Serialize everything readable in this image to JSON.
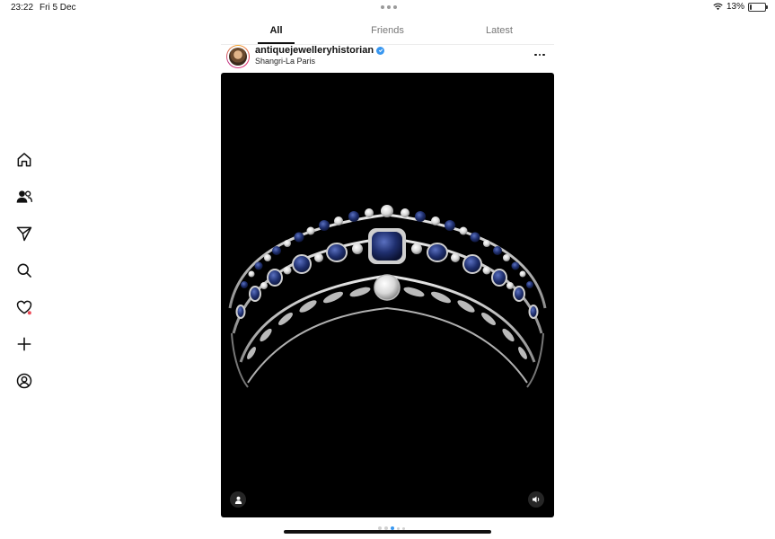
{
  "status": {
    "time": "23:22",
    "date": "Fri 5 Dec",
    "battery": "13%",
    "battery_level": 0.13
  },
  "tabs": [
    {
      "label": "All",
      "active": true
    },
    {
      "label": "Friends",
      "active": false
    },
    {
      "label": "Latest",
      "active": false
    }
  ],
  "sidebar": {
    "items": [
      {
        "name": "home-icon"
      },
      {
        "name": "people-icon"
      },
      {
        "name": "direct-icon"
      },
      {
        "name": "search-icon"
      },
      {
        "name": "heart-icon",
        "notification_color": "#ed4956"
      },
      {
        "name": "plus-icon"
      },
      {
        "name": "profile-icon"
      }
    ]
  },
  "post": {
    "username": "antiquejewelleryhistorian",
    "verified": true,
    "location": "Shangri-La Paris",
    "media_background": "#000000",
    "carousel": {
      "total": 5,
      "current": 3
    }
  },
  "colors": {
    "accent": "#3897f0",
    "notification": "#ed4956",
    "sapphire": "#1f2f6e"
  }
}
